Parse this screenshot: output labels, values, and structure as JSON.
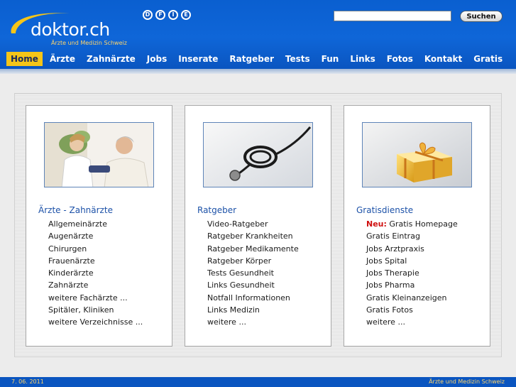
{
  "header": {
    "logo_text": "doktor.ch",
    "logo_subtitle": "Ärzte und Medizin Schweiz",
    "languages": [
      "D",
      "F",
      "I",
      "E"
    ],
    "search": {
      "value": "",
      "placeholder": "",
      "button_label": "Suchen"
    }
  },
  "nav": {
    "items": [
      "Home",
      "Ärzte",
      "Zahnärzte",
      "Jobs",
      "Inserate",
      "Ratgeber",
      "Tests",
      "Fun",
      "Links",
      "Fotos",
      "Kontakt",
      "Gratis"
    ],
    "active": "Home"
  },
  "columns": [
    {
      "title": "Ärzte - Zahnärzte",
      "image": "doctor-patient-photo",
      "links": [
        "Allgemeinärzte",
        "Augenärzte",
        "Chirurgen",
        "Frauenärzte",
        "Kinderärzte",
        "Zahnärzte",
        "weitere Fachärzte ...",
        "Spitäler, Kliniken",
        "weitere Verzeichnisse ..."
      ]
    },
    {
      "title": "Ratgeber",
      "image": "stethoscope-photo",
      "links": [
        "Video-Ratgeber",
        "Ratgeber Krankheiten",
        "Ratgeber Medikamente",
        "Ratgeber Körper",
        "Tests Gesundheit",
        "Links Gesundheit",
        "Notfall Informationen",
        "Links Medizin",
        "weitere ..."
      ]
    },
    {
      "title": "Gratisdienste",
      "image": "gift-box-photo",
      "new_label": "Neu:",
      "links": [
        "Gratis Homepage",
        "Gratis Eintrag",
        "Jobs Arztpraxis",
        "Jobs Spital",
        "Jobs Therapie",
        "Jobs Pharma",
        "Gratis Kleinanzeigen",
        "Gratis Fotos",
        "weitere ..."
      ]
    }
  ],
  "footer": {
    "date": "7. 06. 2011",
    "right_text": "Ärzte und Medizin Schweiz"
  },
  "colors": {
    "header_blue": "#0f66d8",
    "nav_active": "#f5c518",
    "title_blue": "#1d52a8",
    "new_red": "#d01010",
    "footer_text": "#ffd56a"
  }
}
